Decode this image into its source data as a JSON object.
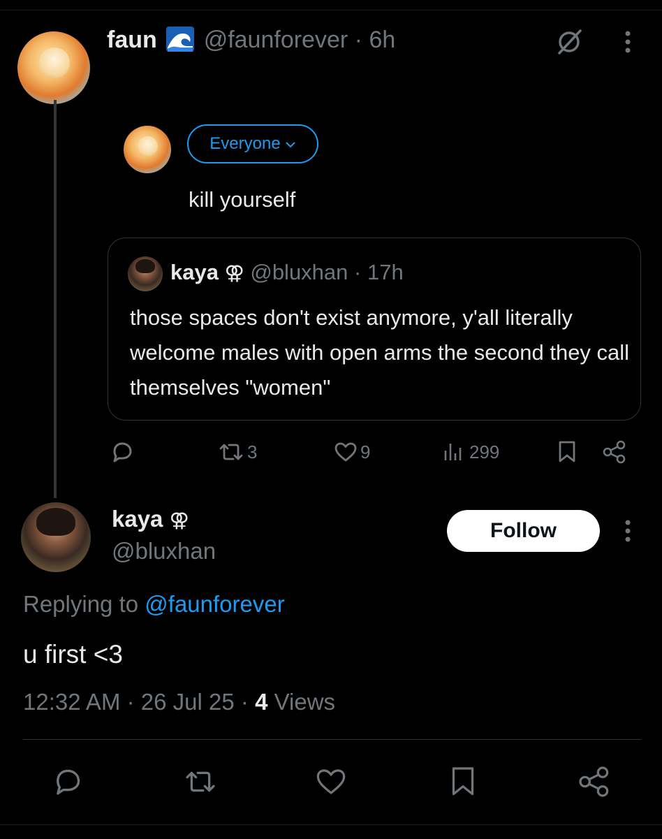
{
  "original_tweet": {
    "author_name": "faun",
    "author_handle": "@faunforever",
    "separator": "·",
    "time": "6h",
    "emoji": "wave-emoji"
  },
  "compose": {
    "audience_label": "Everyone",
    "text": "kill yourself"
  },
  "quoted_tweet": {
    "author_name": "kaya",
    "author_symbol": "⚢",
    "author_handle": "@bluxhan",
    "separator": "·",
    "time": "17h",
    "body": "those spaces don't exist anymore, y'all literally welcome males with open arms the second they call themselves \"women\""
  },
  "tweet_actions": {
    "retweets": "3",
    "likes": "9",
    "views": "299"
  },
  "reply": {
    "author_name": "kaya",
    "author_symbol": "⚢",
    "author_handle": "@bluxhan",
    "follow_label": "Follow",
    "replying_prefix": "Replying to",
    "replying_handle": "@faunforever",
    "text": "u first <3",
    "time": "12:32 AM",
    "separator": "·",
    "date": "26 Jul 25",
    "views_count": "4",
    "views_label": "Views"
  },
  "colors": {
    "background": "#000000",
    "text": "#e7e9ea",
    "muted": "#71767b",
    "accent": "#1d9bf0",
    "border": "#2f3336"
  }
}
